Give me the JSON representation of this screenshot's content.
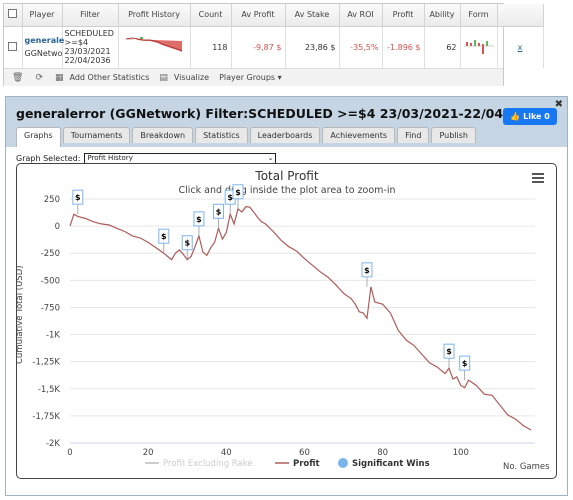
{
  "stats_table": {
    "columns": [
      "Player",
      "Filter",
      "Profit History",
      "Count",
      "Av Profit",
      "Av Stake",
      "Av ROI",
      "Profit",
      "Ability",
      "Form"
    ],
    "row": {
      "player_name": "generale",
      "player_network": "GGNetwo",
      "filter_lines": [
        "SCHEDULED",
        ">=$4",
        "23/03/2021",
        "22/04/2036"
      ],
      "count": "118",
      "av_profit": "-9,87 $",
      "av_stake": "23,86 $",
      "av_roi": "-35,5%",
      "profit": "-1.896 $",
      "ability": "62",
      "remove_link": "x"
    },
    "toolbar": {
      "add_stats_label": "Add Other Statistics",
      "visualize_label": "Visualize",
      "player_groups_label": "Player Groups"
    }
  },
  "window": {
    "title": "generalerror (GGNetwork) Filter:SCHEDULED >=$4 23/03/2021-22/04/2036",
    "like_label": "Like 0",
    "tabs": [
      "Graphs",
      "Tournaments",
      "Breakdown",
      "Statistics",
      "Leaderboards",
      "Achievements",
      "Find",
      "Publish"
    ],
    "active_tab": "Graphs",
    "graph_selected_label": "Graph Selected:",
    "graph_selected_value": "Profit History"
  },
  "colors": {
    "profit_line": "#b05a5a",
    "excl_rake_line": "#cccccc",
    "significant_marker": "#7cb5ec",
    "header_bg": "#c5d5e3",
    "negative": "#d9534f"
  },
  "chart_data": {
    "type": "line",
    "title": "Total Profit",
    "subtitle": "Click and drag inside the plot area to zoom-in",
    "ylabel": "Cumulative Total (USD)",
    "xlabel": "No. Games",
    "ylim": [
      -2000,
      250
    ],
    "xlim": [
      0,
      119
    ],
    "y_ticks": [
      {
        "v": 250,
        "label": "250"
      },
      {
        "v": 0,
        "label": "0"
      },
      {
        "v": -250,
        "label": "-250"
      },
      {
        "v": -500,
        "label": "-500"
      },
      {
        "v": -750,
        "label": "-750"
      },
      {
        "v": -1000,
        "label": "-1K"
      },
      {
        "v": -1250,
        "label": "-1,25K"
      },
      {
        "v": -1500,
        "label": "-1,5K"
      },
      {
        "v": -1750,
        "label": "-1,75K"
      },
      {
        "v": -2000,
        "label": "-2K"
      }
    ],
    "x_ticks": [
      0,
      20,
      40,
      60,
      80,
      100
    ],
    "legend": [
      "Profit Excluding Rake",
      "Profit",
      "Significant Wins"
    ],
    "series": [
      {
        "name": "Profit",
        "x": [
          0,
          1,
          2,
          4,
          6,
          8,
          10,
          12,
          14,
          16,
          18,
          20,
          22,
          24,
          25,
          26,
          27,
          28,
          29,
          30,
          31,
          32,
          33,
          34,
          35,
          36,
          37,
          38,
          39,
          40,
          41,
          42,
          43,
          44,
          45,
          46,
          47,
          48,
          49,
          50,
          52,
          54,
          56,
          58,
          60,
          62,
          64,
          66,
          68,
          70,
          72,
          73,
          74,
          75,
          76,
          77,
          78,
          80,
          82,
          84,
          86,
          88,
          90,
          92,
          94,
          96,
          97,
          98,
          99,
          100,
          101,
          102,
          104,
          106,
          108,
          110,
          112,
          114,
          116,
          118
        ],
        "y": [
          0,
          110,
          90,
          70,
          40,
          20,
          10,
          -20,
          -50,
          -90,
          -110,
          -150,
          -200,
          -250,
          -280,
          -310,
          -250,
          -220,
          -260,
          -310,
          -280,
          -190,
          -90,
          -240,
          -270,
          -200,
          -150,
          -20,
          -120,
          -60,
          110,
          20,
          160,
          130,
          180,
          175,
          130,
          80,
          40,
          20,
          -50,
          -130,
          -190,
          -230,
          -300,
          -360,
          -420,
          -470,
          -540,
          -620,
          -670,
          -720,
          -790,
          -800,
          -850,
          -560,
          -700,
          -720,
          -800,
          -960,
          -1050,
          -1100,
          -1180,
          -1260,
          -1300,
          -1360,
          -1310,
          -1410,
          -1390,
          -1470,
          -1490,
          -1420,
          -1470,
          -1550,
          -1560,
          -1650,
          -1740,
          -1780,
          -1840,
          -1880
        ]
      }
    ],
    "significant_wins": [
      {
        "x": 2,
        "y": 110
      },
      {
        "x": 24,
        "y": -250
      },
      {
        "x": 30,
        "y": -310
      },
      {
        "x": 33,
        "y": -90
      },
      {
        "x": 38,
        "y": -20
      },
      {
        "x": 41,
        "y": 110
      },
      {
        "x": 43,
        "y": 160
      },
      {
        "x": 76,
        "y": -560
      },
      {
        "x": 97,
        "y": -1310
      },
      {
        "x": 101,
        "y": -1420
      }
    ],
    "flag_label": "$",
    "grid": true,
    "legend_position": "bottom"
  }
}
